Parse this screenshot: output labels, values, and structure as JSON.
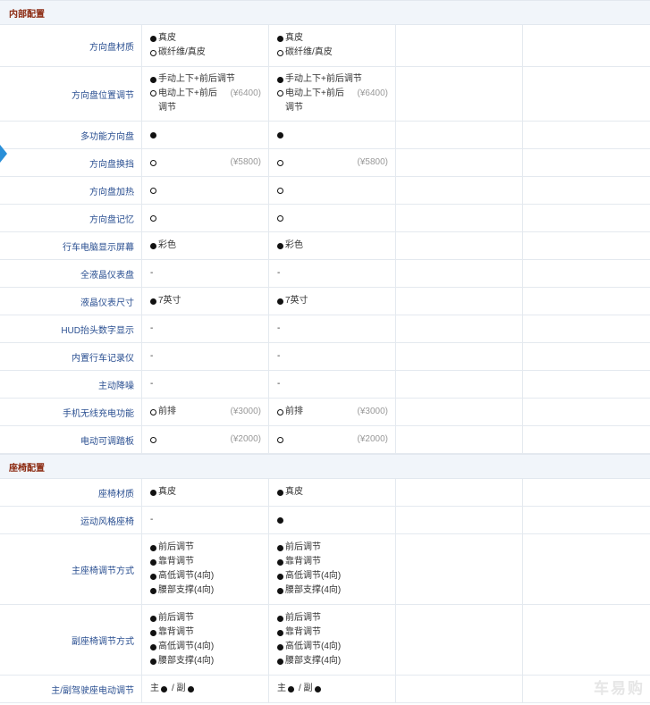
{
  "sections": [
    {
      "title": "内部配置",
      "rows": [
        {
          "label": "方向盘材质",
          "cells": [
            {
              "lines": [
                {
                  "m": "std",
                  "t": "真皮"
                },
                {
                  "m": "opt",
                  "t": "碳纤维/真皮"
                }
              ]
            },
            {
              "lines": [
                {
                  "m": "std",
                  "t": "真皮"
                },
                {
                  "m": "opt",
                  "t": "碳纤维/真皮"
                }
              ]
            },
            {},
            {}
          ]
        },
        {
          "label": "方向盘位置调节",
          "cells": [
            {
              "lines": [
                {
                  "m": "std",
                  "t": "手动上下+前后调节"
                },
                {
                  "m": "opt",
                  "t": "电动上下+前后调节",
                  "wrap": true,
                  "price": "(¥6400)"
                }
              ]
            },
            {
              "lines": [
                {
                  "m": "std",
                  "t": "手动上下+前后调节"
                },
                {
                  "m": "opt",
                  "t": "电动上下+前后调节",
                  "wrap": true,
                  "price": "(¥6400)"
                }
              ]
            },
            {},
            {}
          ]
        },
        {
          "label": "多功能方向盘",
          "cells": [
            {
              "lines": [
                {
                  "m": "std",
                  "t": ""
                }
              ]
            },
            {
              "lines": [
                {
                  "m": "std",
                  "t": ""
                }
              ]
            },
            {},
            {}
          ]
        },
        {
          "label": "方向盘换挡",
          "cells": [
            {
              "lines": [
                {
                  "m": "opt",
                  "t": "",
                  "price": "(¥5800)"
                }
              ]
            },
            {
              "lines": [
                {
                  "m": "opt",
                  "t": "",
                  "price": "(¥5800)"
                }
              ]
            },
            {},
            {}
          ]
        },
        {
          "label": "方向盘加热",
          "cells": [
            {
              "lines": [
                {
                  "m": "opt",
                  "t": ""
                }
              ]
            },
            {
              "lines": [
                {
                  "m": "opt",
                  "t": ""
                }
              ]
            },
            {},
            {}
          ]
        },
        {
          "label": "方向盘记忆",
          "cells": [
            {
              "lines": [
                {
                  "m": "opt",
                  "t": ""
                }
              ]
            },
            {
              "lines": [
                {
                  "m": "opt",
                  "t": ""
                }
              ]
            },
            {},
            {}
          ]
        },
        {
          "label": "行车电脑显示屏幕",
          "cells": [
            {
              "lines": [
                {
                  "m": "std",
                  "t": "彩色"
                }
              ]
            },
            {
              "lines": [
                {
                  "m": "std",
                  "t": "彩色"
                }
              ]
            },
            {},
            {}
          ]
        },
        {
          "label": "全液晶仪表盘",
          "cells": [
            {
              "lines": [
                {
                  "m": "",
                  "t": "-"
                }
              ]
            },
            {
              "lines": [
                {
                  "m": "",
                  "t": "-"
                }
              ]
            },
            {},
            {}
          ]
        },
        {
          "label": "液晶仪表尺寸",
          "cells": [
            {
              "lines": [
                {
                  "m": "std",
                  "t": "7英寸"
                }
              ]
            },
            {
              "lines": [
                {
                  "m": "std",
                  "t": "7英寸"
                }
              ]
            },
            {},
            {}
          ]
        },
        {
          "label": "HUD抬头数字显示",
          "cells": [
            {
              "lines": [
                {
                  "m": "",
                  "t": "-"
                }
              ]
            },
            {
              "lines": [
                {
                  "m": "",
                  "t": "-"
                }
              ]
            },
            {},
            {}
          ]
        },
        {
          "label": "内置行车记录仪",
          "cells": [
            {
              "lines": [
                {
                  "m": "",
                  "t": "-"
                }
              ]
            },
            {
              "lines": [
                {
                  "m": "",
                  "t": "-"
                }
              ]
            },
            {},
            {}
          ]
        },
        {
          "label": "主动降噪",
          "cells": [
            {
              "lines": [
                {
                  "m": "",
                  "t": "-"
                }
              ]
            },
            {
              "lines": [
                {
                  "m": "",
                  "t": "-"
                }
              ]
            },
            {},
            {}
          ]
        },
        {
          "label": "手机无线充电功能",
          "cells": [
            {
              "lines": [
                {
                  "m": "opt",
                  "t": "前排",
                  "price": "(¥3000)"
                }
              ]
            },
            {
              "lines": [
                {
                  "m": "opt",
                  "t": "前排",
                  "price": "(¥3000)"
                }
              ]
            },
            {},
            {}
          ]
        },
        {
          "label": "电动可调踏板",
          "cells": [
            {
              "lines": [
                {
                  "m": "opt",
                  "t": "",
                  "price": "(¥2000)"
                }
              ]
            },
            {
              "lines": [
                {
                  "m": "opt",
                  "t": "",
                  "price": "(¥2000)"
                }
              ]
            },
            {},
            {}
          ]
        }
      ]
    },
    {
      "title": "座椅配置",
      "rows": [
        {
          "label": "座椅材质",
          "cells": [
            {
              "lines": [
                {
                  "m": "std",
                  "t": "真皮"
                }
              ]
            },
            {
              "lines": [
                {
                  "m": "std",
                  "t": "真皮"
                }
              ]
            },
            {},
            {}
          ]
        },
        {
          "label": "运动风格座椅",
          "cells": [
            {
              "lines": [
                {
                  "m": "",
                  "t": "-"
                }
              ]
            },
            {
              "lines": [
                {
                  "m": "std",
                  "t": ""
                }
              ]
            },
            {},
            {}
          ]
        },
        {
          "label": "主座椅调节方式",
          "cells": [
            {
              "lines": [
                {
                  "m": "std",
                  "t": "前后调节"
                },
                {
                  "m": "std",
                  "t": "靠背调节"
                },
                {
                  "m": "std",
                  "t": "高低调节(4向)"
                },
                {
                  "m": "std",
                  "t": "腰部支撑(4向)"
                }
              ]
            },
            {
              "lines": [
                {
                  "m": "std",
                  "t": "前后调节"
                },
                {
                  "m": "std",
                  "t": "靠背调节"
                },
                {
                  "m": "std",
                  "t": "高低调节(4向)"
                },
                {
                  "m": "std",
                  "t": "腰部支撑(4向)"
                }
              ]
            },
            {},
            {}
          ]
        },
        {
          "label": "副座椅调节方式",
          "cells": [
            {
              "lines": [
                {
                  "m": "std",
                  "t": "前后调节"
                },
                {
                  "m": "std",
                  "t": "靠背调节"
                },
                {
                  "m": "std",
                  "t": "高低调节(4向)"
                },
                {
                  "m": "std",
                  "t": "腰部支撑(4向)"
                }
              ]
            },
            {
              "lines": [
                {
                  "m": "std",
                  "t": "前后调节"
                },
                {
                  "m": "std",
                  "t": "靠背调节"
                },
                {
                  "m": "std",
                  "t": "高低调节(4向)"
                },
                {
                  "m": "std",
                  "t": "腰部支撑(4向)"
                }
              ]
            },
            {},
            {}
          ]
        },
        {
          "label": "主/副驾驶座电动调节",
          "cells": [
            {
              "lines": [
                {
                  "m": "",
                  "t": "",
                  "split": [
                    "主",
                    "/ 副"
                  ]
                }
              ]
            },
            {
              "lines": [
                {
                  "m": "",
                  "t": "",
                  "split": [
                    "主",
                    "/ 副"
                  ]
                }
              ]
            },
            {},
            {}
          ]
        }
      ]
    }
  ],
  "watermark": "车易购",
  "colors": {
    "section_title": "#8c2b12",
    "label": "#2a4f91",
    "price": "#999999",
    "arrow": "#2a8fd8"
  }
}
